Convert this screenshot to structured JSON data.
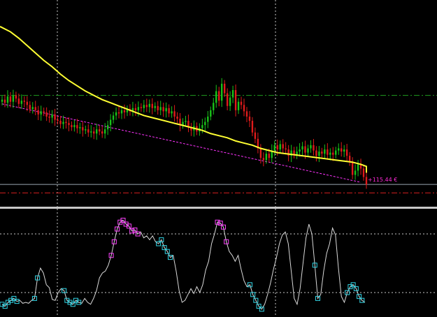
{
  "colors": {
    "background": "#000000",
    "bull_candle": "#19c219",
    "bear_candle": "#e01b1b",
    "moving_average": "#ffff33",
    "trendline": "#ff33ff",
    "green_level": "#1f9e1f",
    "red_level": "#d91f1f",
    "current_level": "#9aa6b2",
    "oscillator": "#d8d8d8",
    "overbought_marker": "#ff44ff",
    "oversold_marker": "#33d6e6",
    "grid": "#c8c8c8",
    "panel_separator": "#c8c8c8"
  },
  "position_label": "+115.44 €",
  "chart_data": [
    {
      "type": "candlestick",
      "panel": "price",
      "close": [
        100.6,
        100.3,
        100.9,
        100.4,
        101.0,
        100.7,
        100.2,
        100.5,
        100.4,
        100.1,
        99.7,
        99.9,
        99.6,
        99.2,
        99.5,
        99.4,
        99.0,
        98.9,
        99.2,
        98.7,
        98.6,
        98.3,
        98.5,
        98.4,
        98.2,
        98.0,
        98.2,
        97.9,
        98.0,
        97.7,
        97.8,
        97.5,
        97.6,
        97.4,
        97.8,
        97.6,
        97.4,
        97.8,
        98.2,
        98.7,
        99.1,
        99.4,
        99.3,
        99.6,
        99.4,
        99.7,
        99.5,
        99.8,
        99.6,
        99.9,
        99.8,
        100.1,
        99.9,
        100.2,
        99.8,
        100.0,
        99.6,
        99.9,
        99.5,
        99.8,
        99.3,
        99.5,
        99.0,
        98.8,
        98.2,
        98.5,
        98.6,
        98.0,
        97.7,
        98.1,
        97.6,
        97.9,
        98.2,
        98.5,
        99.0,
        99.6,
        100.3,
        101.4,
        100.5,
        102.1,
        101.2,
        100.0,
        100.8,
        101.5,
        99.6,
        100.4,
        100.1,
        99.5,
        99.0,
        98.6,
        97.5,
        96.9,
        96.0,
        95.1,
        94.9,
        95.5,
        95.1,
        95.8,
        96.3,
        95.9,
        96.4,
        96.0,
        95.9,
        95.3,
        95.8,
        95.4,
        95.7,
        95.9,
        96.2,
        95.6,
        96.0,
        96.3,
        95.8,
        95.3,
        95.7,
        95.5,
        95.9,
        95.4,
        95.6,
        95.4,
        95.8,
        96.0,
        95.7,
        95.9,
        95.3,
        94.7,
        93.5,
        93.9,
        94.5,
        94.1,
        93.3,
        92.6
      ],
      "moving_average": [
        107.5,
        107.0,
        106.4,
        105.7,
        105.0,
        104.3,
        103.7,
        103.0,
        102.4,
        101.9,
        101.4,
        101.0,
        100.6,
        100.3,
        100.0,
        99.7,
        99.4,
        99.1,
        98.9,
        98.7,
        98.5,
        98.3,
        98.1,
        97.9,
        97.7,
        97.4,
        97.2,
        97.0,
        96.7,
        96.5,
        96.3,
        96.0,
        95.8,
        95.6,
        95.5,
        95.4,
        95.3,
        95.2,
        95.1,
        95.0,
        94.9,
        94.8,
        94.7,
        94.5,
        94.3,
        94.0,
        93.7
      ],
      "ma_start_index": 0,
      "ma_step": 3,
      "levels": [
        101.0,
        92.6,
        91.8
      ],
      "trendline": {
        "start_index": 0,
        "start": 100.2,
        "end_index": 129,
        "end": 92.8
      },
      "ylim": [
        90.5,
        110
      ]
    },
    {
      "type": "line",
      "panel": "oscillator",
      "values": [
        8,
        6,
        10,
        12,
        14,
        11,
        12,
        9,
        10,
        9,
        12,
        14,
        35,
        45,
        40,
        28,
        25,
        13,
        12,
        20,
        24,
        22,
        12,
        10,
        8,
        12,
        10,
        9,
        14,
        10,
        8,
        14,
        22,
        35,
        40,
        42,
        48,
        58,
        72,
        85,
        92,
        94,
        90,
        88,
        83,
        84,
        80,
        82,
        76,
        78,
        74,
        78,
        72,
        70,
        74,
        66,
        62,
        56,
        58,
        42,
        22,
        10,
        12,
        18,
        24,
        19,
        26,
        20,
        28,
        43,
        52,
        70,
        80,
        92,
        91,
        87,
        72,
        62,
        58,
        52,
        58,
        44,
        32,
        26,
        28,
        18,
        12,
        6,
        3,
        8,
        18,
        30,
        44,
        56,
        70,
        79,
        82,
        70,
        42,
        14,
        8,
        24,
        50,
        76,
        90,
        80,
        48,
        14,
        18,
        42,
        60,
        70,
        86,
        79,
        45,
        16,
        10,
        20,
        26,
        28,
        24,
        16,
        12,
        10
      ],
      "overbought_marker_indices": [
        37,
        38,
        39,
        40,
        41,
        42,
        43,
        44,
        45,
        46,
        73,
        74,
        75,
        76
      ],
      "oversold_marker_indices": [
        0,
        1,
        2,
        3,
        4,
        5,
        11,
        12,
        21,
        22,
        23,
        24,
        25,
        26,
        53,
        54,
        55,
        56,
        57,
        84,
        85,
        86,
        87,
        88,
        106,
        107,
        117,
        118,
        119,
        120,
        121,
        122
      ],
      "overbought_level": 80,
      "oversold_level": 20,
      "ylim": [
        0,
        100
      ]
    }
  ]
}
